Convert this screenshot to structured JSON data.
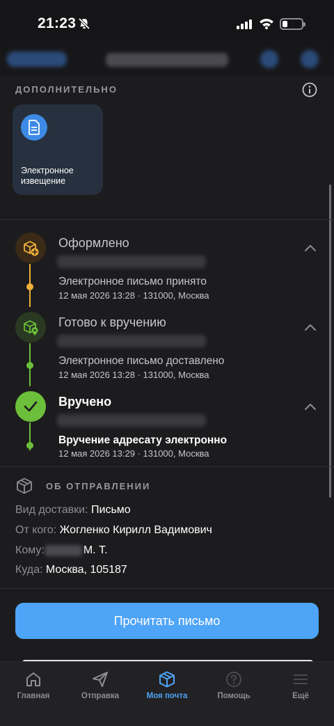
{
  "status_bar": {
    "time": "21:23"
  },
  "extra": {
    "title": "ДОПОЛНИТЕЛЬНО",
    "card_label": "Электронное извещение"
  },
  "tracking": [
    {
      "title": "Оформлено",
      "event": "Электронное письмо принято",
      "meta": "12 мая 2026 13:28 · 131000, Москва",
      "color": "#f0b23a"
    },
    {
      "title": "Готово к вручению",
      "event": "Электронное письмо доставлено",
      "meta": "12 мая 2026 13:28 · 131000, Москва",
      "color": "#6cbf3a"
    },
    {
      "title": "Вручено",
      "event": "Вручение адресату электронно",
      "meta": "12 мая 2026 13:29 · 131000, Москва",
      "color": "#6cbf3a"
    }
  ],
  "about": {
    "title": "ОБ ОТПРАВЛЕНИИ",
    "delivery_label": "Вид доставки:",
    "delivery_value": "Письмо",
    "from_label": "От кого:",
    "from_value": "Жогленко Кирилл Вадимович",
    "to_label": "Кому:",
    "to_value": "М. Т.",
    "where_label": "Куда:",
    "where_value": "Москва, 105187"
  },
  "primary_button": "Прочитать письмо",
  "tabs": [
    {
      "label": "Главная",
      "icon": "home-icon"
    },
    {
      "label": "Отправка",
      "icon": "send-icon"
    },
    {
      "label": "Моя почта",
      "icon": "box-icon"
    },
    {
      "label": "Помощь",
      "icon": "help-icon"
    },
    {
      "label": "Ещё",
      "icon": "menu-icon"
    }
  ],
  "colors": {
    "accent": "#4ea4f6",
    "success": "#6cbf3a",
    "created": "#f0b23a"
  }
}
